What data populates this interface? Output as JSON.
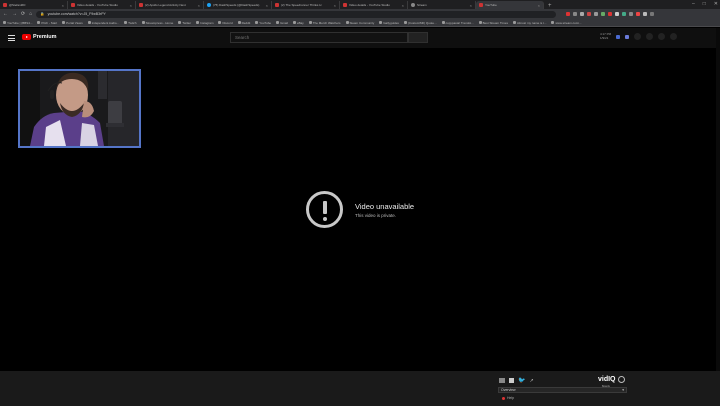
{
  "browser": {
    "tabs": [
      {
        "title": "@StefanZiD",
        "icon": "twitch"
      },
      {
        "title": "Video details - YouTube Studio",
        "icon": "youtube"
      },
      {
        "title": "(2) Apollo Legend Activity Next",
        "icon": "youtube"
      },
      {
        "title": "(75) DashSpeeds (@DashSpeeds)",
        "icon": "twitter"
      },
      {
        "title": "(2) The Speedrunner Thinks H",
        "icon": "youtube"
      },
      {
        "title": "Video details - YouTube Studio",
        "icon": "youtube"
      },
      {
        "title": "Stream",
        "icon": "gray"
      },
      {
        "title": "YouTube",
        "icon": "youtube",
        "active": true
      }
    ],
    "new_tab": "+",
    "url": "youtube.com/watch?v=J5_F9wB3rPY",
    "bookmarks": [
      "YouTube | (BBS4...",
      "Pitch - Start",
      "Portal Views",
      "independent Audio...",
      "Twitch",
      "Streampress - Home",
      "Twitter",
      "Instagram",
      "Discord",
      "Reddit",
      "YouTube",
      "Gmail",
      "eBay",
      "The Merch Watchers",
      "Steam Community",
      "Gallyguides",
      "(Custom/MIl) Quote...",
      "copypasta! Trendot...",
      "Best Stream Times",
      "Almost my name is t...",
      "www.stream.comi..."
    ]
  },
  "youtube": {
    "logo_text": "Premium",
    "search_placeholder": "Search",
    "clock": [
      "4:17 PM",
      "1/9/21"
    ]
  },
  "player": {
    "error_title": "Video unavailable",
    "error_subtitle": "This video is private."
  },
  "bottom": {
    "vidiq_brand": "vidIQ",
    "vidiq_powered": "Boards",
    "select_value": "Overview",
    "link_text": "Help"
  }
}
